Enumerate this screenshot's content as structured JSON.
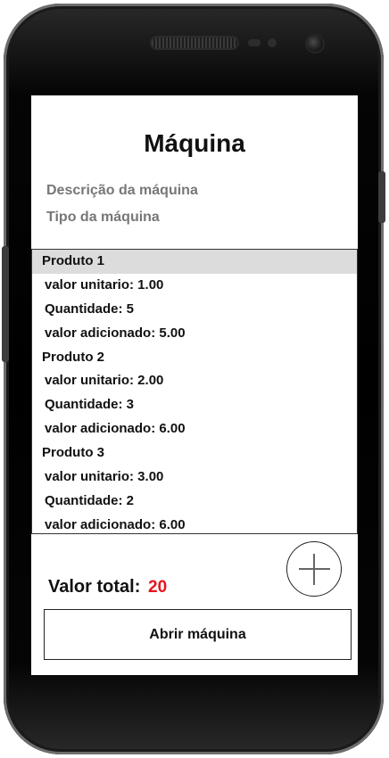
{
  "screen": {
    "title": "Máquina",
    "description_placeholder": "Descrição da máquina",
    "type_placeholder": "Tipo da máquina"
  },
  "products": [
    {
      "name": "Produto 1",
      "unit_value_text": "valor unitario: 1.00",
      "quantity_text": "Quantidade: 5",
      "added_value_text": "valor adicionado: 5.00",
      "selected": true
    },
    {
      "name": "Produto 2",
      "unit_value_text": "valor unitario: 2.00",
      "quantity_text": "Quantidade: 3",
      "added_value_text": "valor adicionado: 6.00",
      "selected": false
    },
    {
      "name": "Produto 3",
      "unit_value_text": "valor unitario: 3.00",
      "quantity_text": "Quantidade: 2",
      "added_value_text": "valor adicionado: 6.00",
      "selected": false
    }
  ],
  "total": {
    "label": "Valor total:",
    "value": "20",
    "value_color": "#e8141b"
  },
  "actions": {
    "add_icon": "plus-icon",
    "open_button_label": "Abrir máquina"
  },
  "colors": {
    "selected_row": "#dcdcdc",
    "placeholder_text": "#777777"
  }
}
